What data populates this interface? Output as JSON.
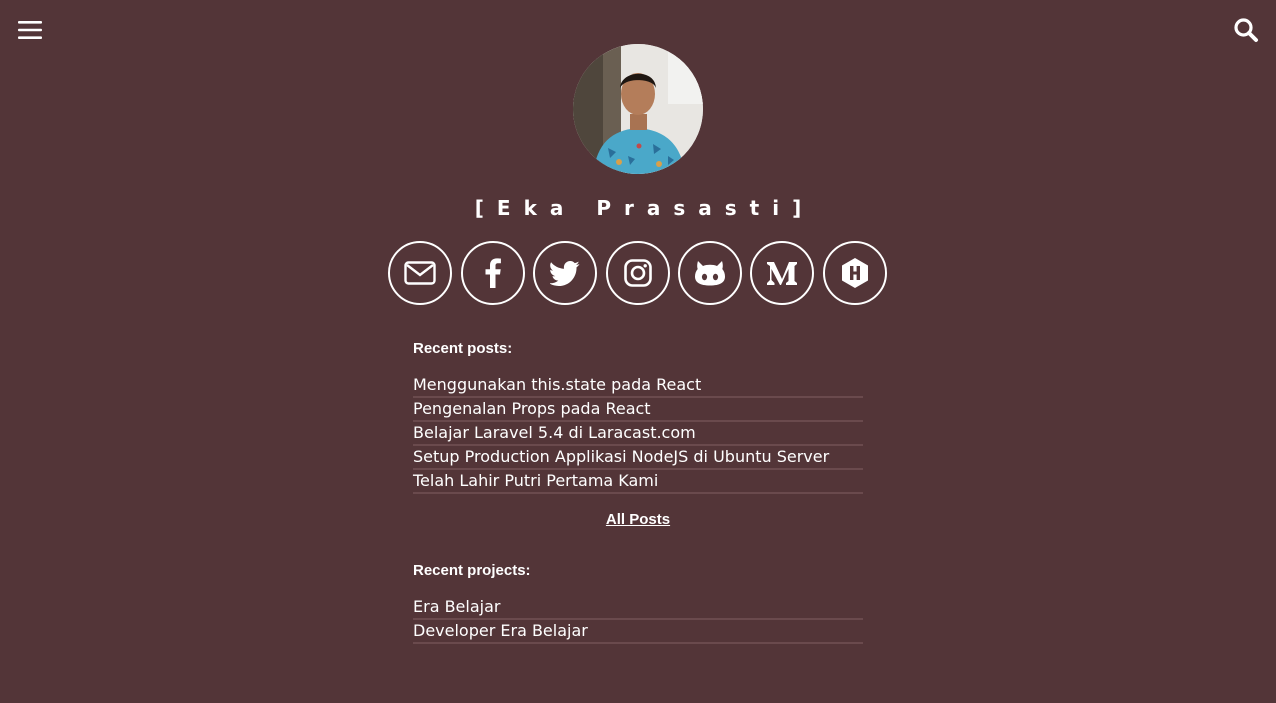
{
  "header": {
    "menu_icon": "hamburger-menu-icon",
    "search_icon": "search-icon"
  },
  "profile": {
    "name": "[Eka Prasasti]",
    "avatar_icon": "profile-photo"
  },
  "social": [
    {
      "name": "email",
      "icon": "envelope-icon"
    },
    {
      "name": "facebook",
      "icon": "facebook-icon"
    },
    {
      "name": "twitter",
      "icon": "twitter-icon"
    },
    {
      "name": "instagram",
      "icon": "instagram-icon"
    },
    {
      "name": "github",
      "icon": "github-icon"
    },
    {
      "name": "medium",
      "icon": "medium-icon"
    },
    {
      "name": "hashnode",
      "icon": "hashnode-icon"
    }
  ],
  "recent_posts": {
    "title": "Recent posts:",
    "items": [
      "Menggunakan this.state pada React",
      "Pengenalan Props pada React",
      "Belajar Laravel 5.4 di Laracast.com",
      "Setup Production Applikasi NodeJS di Ubuntu Server",
      "Telah Lahir Putri Pertama Kami"
    ],
    "all_label": "All Posts"
  },
  "recent_projects": {
    "title": "Recent projects:",
    "items": [
      "Era Belajar",
      "Developer Era Belajar"
    ]
  },
  "colors": {
    "background": "#533538",
    "text": "#ffffff",
    "divider": "#6a4a4d"
  }
}
